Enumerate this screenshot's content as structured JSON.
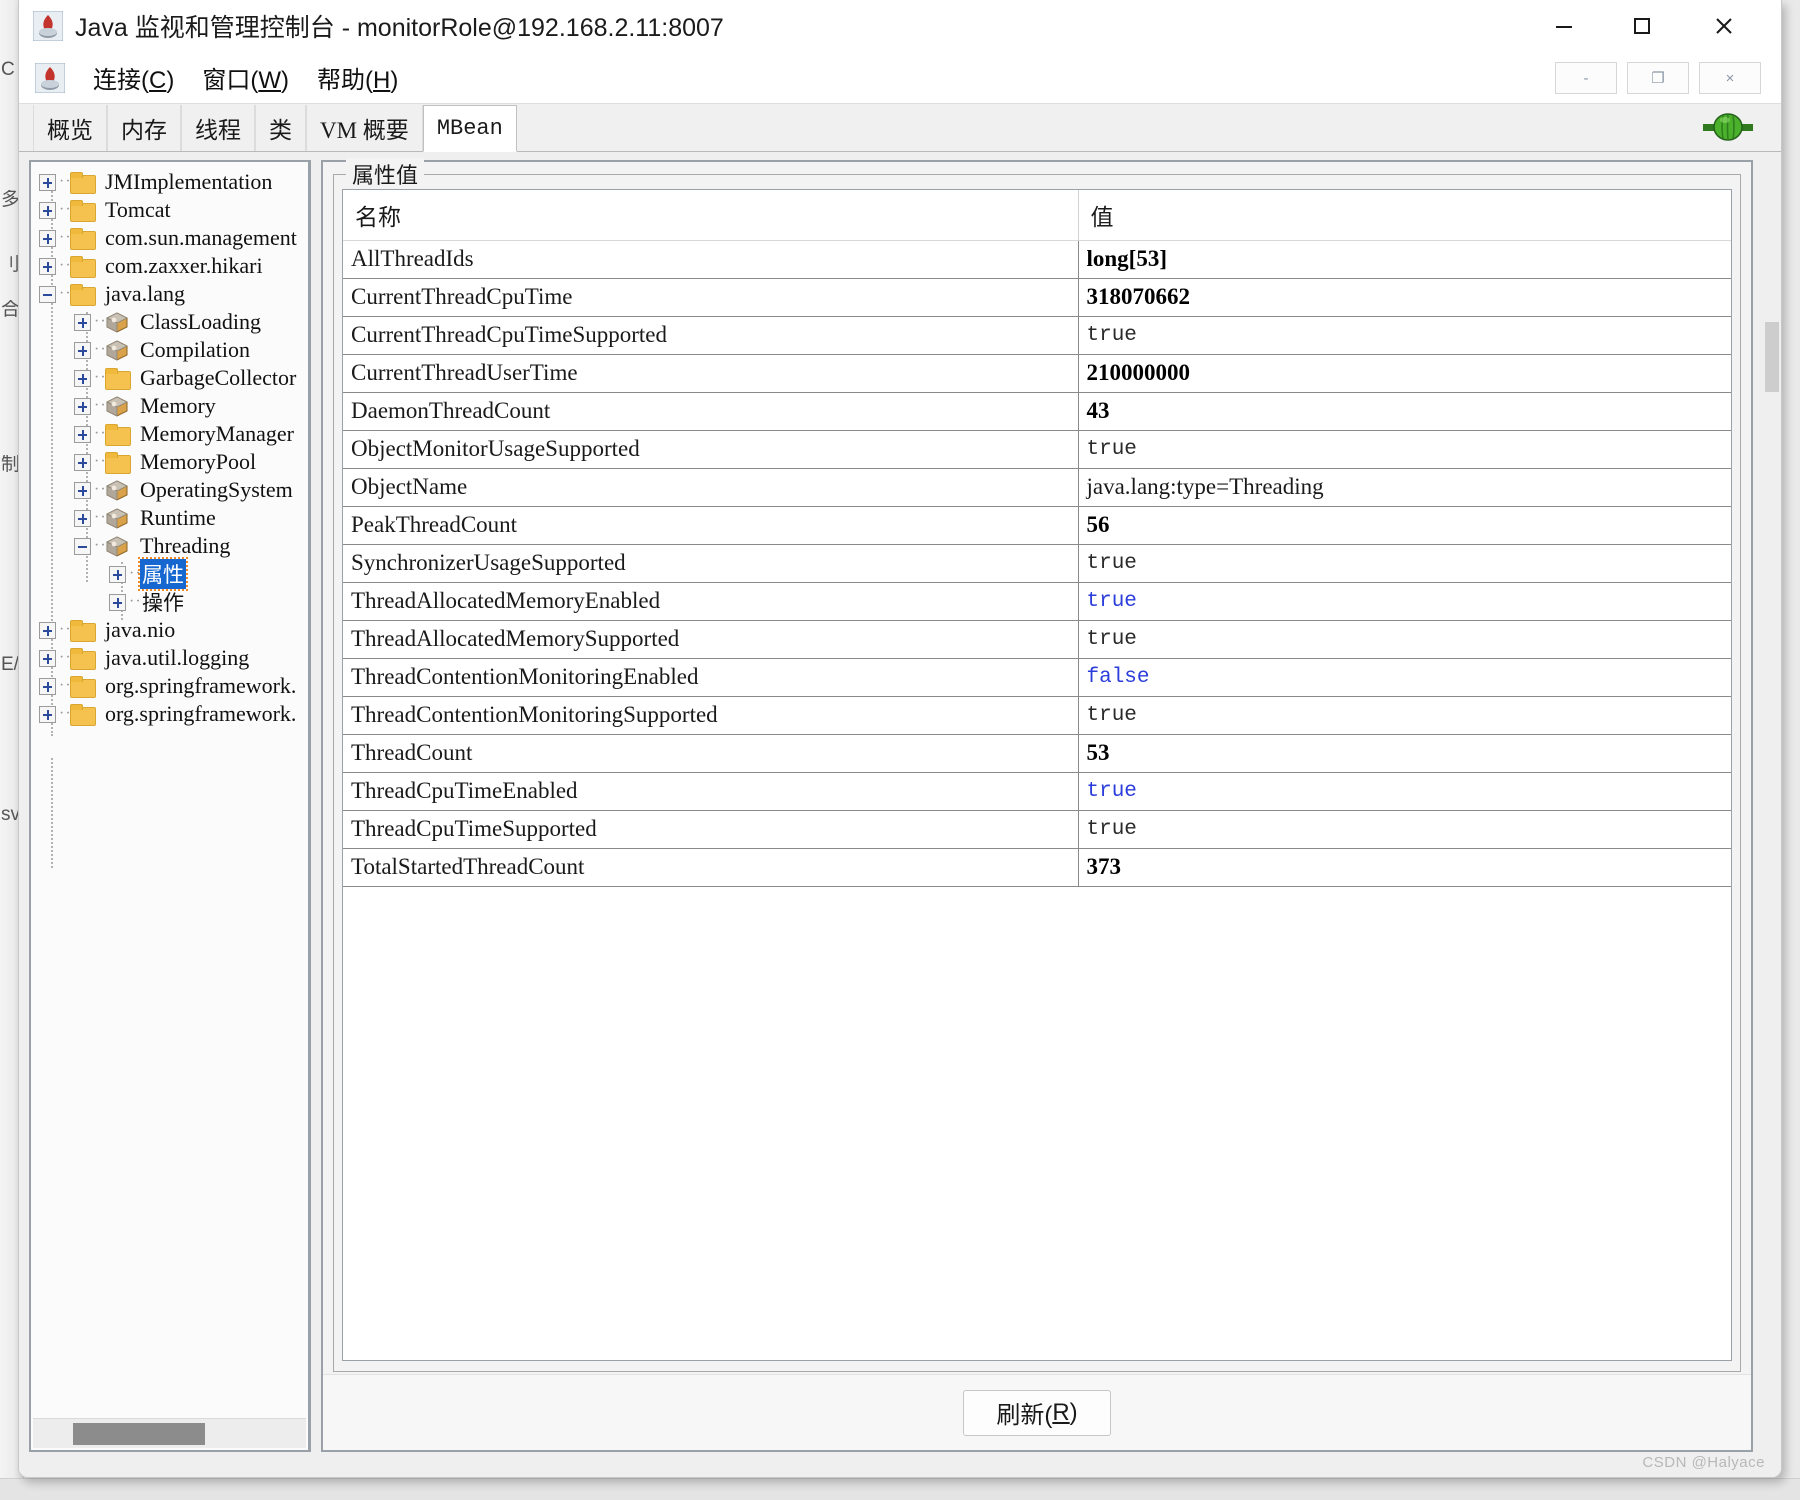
{
  "window": {
    "title": "Java 监视和管理控制台 - monitorRole@192.168.2.11:8007",
    "app_icon": "java-duke-icon",
    "controls": {
      "minimize": "minimize-icon",
      "maximize": "maximize-icon",
      "close": "close-icon"
    },
    "inner_controls": {
      "minimize": "-",
      "restore": "❐",
      "close": "×"
    }
  },
  "menubar": {
    "icon": "java-duke-icon",
    "items": [
      {
        "label": "连接(C)",
        "text": "连接",
        "mnemonic": "C"
      },
      {
        "label": "窗口(W)",
        "text": "窗口",
        "mnemonic": "W"
      },
      {
        "label": "帮助(H)",
        "text": "帮助",
        "mnemonic": "H"
      }
    ]
  },
  "tabs": {
    "items": [
      {
        "label": "概览",
        "active": false
      },
      {
        "label": "内存",
        "active": false
      },
      {
        "label": "线程",
        "active": false
      },
      {
        "label": "类",
        "active": false
      },
      {
        "label": "VM 概要",
        "active": false
      },
      {
        "label": "MBean",
        "active": true
      }
    ],
    "status_icon": "green-plug-connected-icon"
  },
  "tree": {
    "nodes": [
      {
        "label": "JMImplementation",
        "icon": "folder-icon",
        "depth": 0,
        "state": "collapsed"
      },
      {
        "label": "Tomcat",
        "icon": "folder-icon",
        "depth": 0,
        "state": "collapsed"
      },
      {
        "label": "com.sun.management",
        "icon": "folder-icon",
        "depth": 0,
        "state": "collapsed"
      },
      {
        "label": "com.zaxxer.hikari",
        "icon": "folder-icon",
        "depth": 0,
        "state": "collapsed"
      },
      {
        "label": "java.lang",
        "icon": "folder-icon",
        "depth": 0,
        "state": "expanded"
      },
      {
        "label": "ClassLoading",
        "icon": "mbean-icon",
        "depth": 1,
        "state": "collapsed"
      },
      {
        "label": "Compilation",
        "icon": "mbean-icon",
        "depth": 1,
        "state": "collapsed"
      },
      {
        "label": "GarbageCollector",
        "icon": "folder-icon",
        "depth": 1,
        "state": "collapsed"
      },
      {
        "label": "Memory",
        "icon": "mbean-icon",
        "depth": 1,
        "state": "collapsed"
      },
      {
        "label": "MemoryManager",
        "icon": "folder-icon",
        "depth": 1,
        "state": "collapsed"
      },
      {
        "label": "MemoryPool",
        "icon": "folder-icon",
        "depth": 1,
        "state": "collapsed"
      },
      {
        "label": "OperatingSystem",
        "icon": "mbean-icon",
        "depth": 1,
        "state": "collapsed"
      },
      {
        "label": "Runtime",
        "icon": "mbean-icon",
        "depth": 1,
        "state": "collapsed"
      },
      {
        "label": "Threading",
        "icon": "mbean-icon",
        "depth": 1,
        "state": "expanded"
      },
      {
        "label": "属性",
        "icon": "none",
        "depth": 2,
        "state": "collapsed",
        "selected": true
      },
      {
        "label": "操作",
        "icon": "none",
        "depth": 2,
        "state": "collapsed"
      },
      {
        "label": "java.nio",
        "icon": "folder-icon",
        "depth": 0,
        "state": "collapsed"
      },
      {
        "label": "java.util.logging",
        "icon": "folder-icon",
        "depth": 0,
        "state": "collapsed"
      },
      {
        "label": "org.springframework.",
        "icon": "folder-icon",
        "depth": 0,
        "state": "collapsed"
      },
      {
        "label": "org.springframework.",
        "icon": "folder-icon",
        "depth": 0,
        "state": "collapsed"
      }
    ],
    "hscrollbar": "horizontal-scrollbar"
  },
  "attributes_panel": {
    "legend": "属性值",
    "columns": {
      "name": "名称",
      "value": "值"
    },
    "rows": [
      {
        "name": "AllThreadIds",
        "value": "long[53]",
        "kind": "num"
      },
      {
        "name": "CurrentThreadCpuTime",
        "value": "318070662",
        "kind": "num"
      },
      {
        "name": "CurrentThreadCpuTimeSupported",
        "value": "true",
        "kind": "bool-ro"
      },
      {
        "name": "CurrentThreadUserTime",
        "value": "210000000",
        "kind": "num"
      },
      {
        "name": "DaemonThreadCount",
        "value": "43",
        "kind": "num"
      },
      {
        "name": "ObjectMonitorUsageSupported",
        "value": "true",
        "kind": "bool-ro"
      },
      {
        "name": "ObjectName",
        "value": "java.lang:type=Threading",
        "kind": "text"
      },
      {
        "name": "PeakThreadCount",
        "value": "56",
        "kind": "num"
      },
      {
        "name": "SynchronizerUsageSupported",
        "value": "true",
        "kind": "bool-ro"
      },
      {
        "name": "ThreadAllocatedMemoryEnabled",
        "value": "true",
        "kind": "bool-rw"
      },
      {
        "name": "ThreadAllocatedMemorySupported",
        "value": "true",
        "kind": "bool-ro"
      },
      {
        "name": "ThreadContentionMonitoringEnabled",
        "value": "false",
        "kind": "bool-rw"
      },
      {
        "name": "ThreadContentionMonitoringSupported",
        "value": "true",
        "kind": "bool-ro"
      },
      {
        "name": "ThreadCount",
        "value": "53",
        "kind": "num"
      },
      {
        "name": "ThreadCpuTimeEnabled",
        "value": "true",
        "kind": "bool-rw"
      },
      {
        "name": "ThreadCpuTimeSupported",
        "value": "true",
        "kind": "bool-ro"
      },
      {
        "name": "TotalStartedThreadCount",
        "value": "373",
        "kind": "num"
      }
    ]
  },
  "footer": {
    "refresh_label": "刷新(R)",
    "refresh_text": "刷新",
    "refresh_mnemonic": "R"
  },
  "watermark": "CSDN @Halyace",
  "background_fragments": {
    "left_column_chars": [
      "多",
      "刂",
      "合",
      "制",
      "E/",
      "sv",
      "C"
    ]
  },
  "colors": {
    "selection_blue": "#1668d0",
    "writable_value_blue": "#2b3ddb",
    "folder_yellow": "#f5c24f",
    "connected_green": "#3f9b29",
    "panel_border": "#9aa0a8"
  }
}
